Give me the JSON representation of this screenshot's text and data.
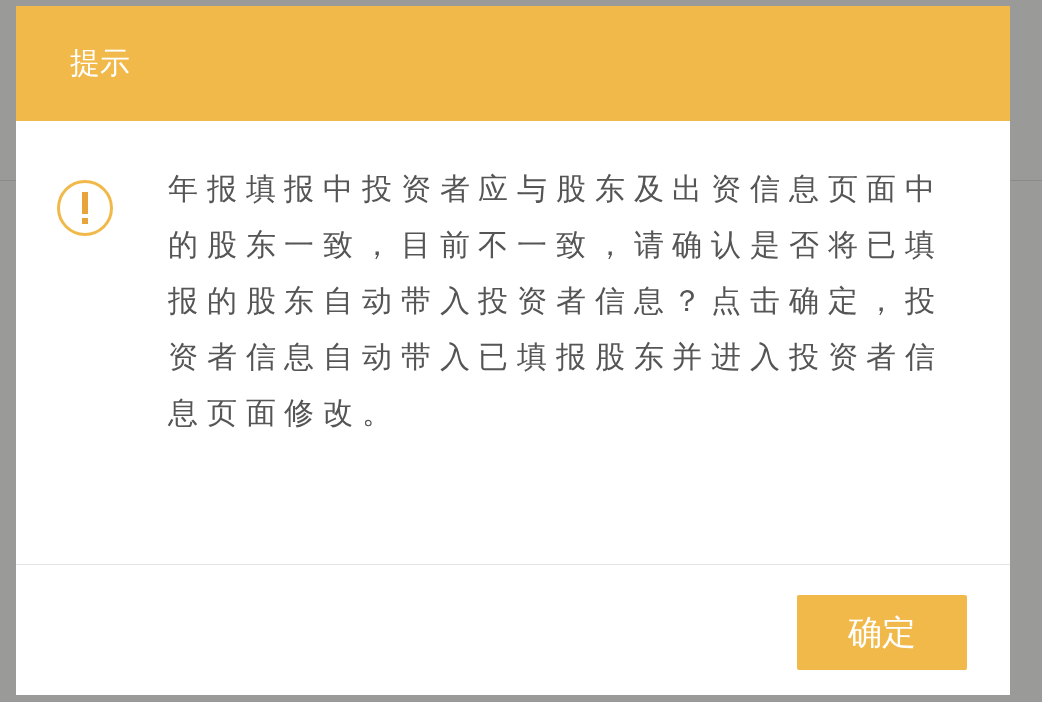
{
  "dialog": {
    "title": "提示",
    "message": "年报填报中投资者应与股东及出资信息页面中的股东一致，目前不一致，请确认是否将已填报的股东自动带入投资者信息？点击确定，投资者信息自动带入已填报股东并进入投资者信息页面修改。",
    "buttons": [
      "确定"
    ]
  }
}
